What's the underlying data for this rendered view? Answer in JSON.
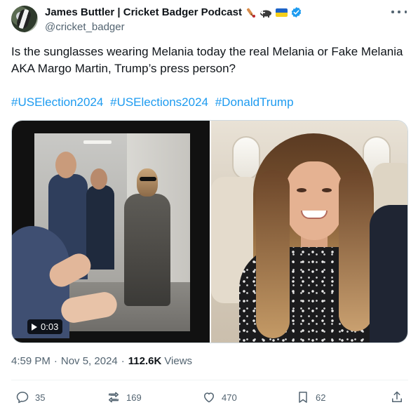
{
  "author": {
    "display_name": "James Buttler | Cricket Badger Podcast",
    "handle": "@cricket_badger",
    "name_emojis": [
      "cricket-bat-icon",
      "badger-icon",
      "ukraine-flag-icon",
      "verified-badge-icon"
    ]
  },
  "tweet": {
    "text": "Is the sunglasses wearing Melania today the real Melania or Fake Melania AKA Margo Martin, Trump’s press person?",
    "hashtags": [
      "#USElection2024",
      "#USElections2024",
      "#DonaldTrump"
    ]
  },
  "media": {
    "video_duration": "0:03"
  },
  "meta": {
    "time": "4:59 PM",
    "date": "Nov 5, 2024",
    "views_count": "112.6K",
    "views_label": "Views"
  },
  "actions": {
    "replies": "35",
    "retweets": "169",
    "likes": "470",
    "bookmarks": "62"
  },
  "colors": {
    "link": "#1d9bf0",
    "secondary_text": "#536471",
    "primary_text": "#0f1419"
  }
}
